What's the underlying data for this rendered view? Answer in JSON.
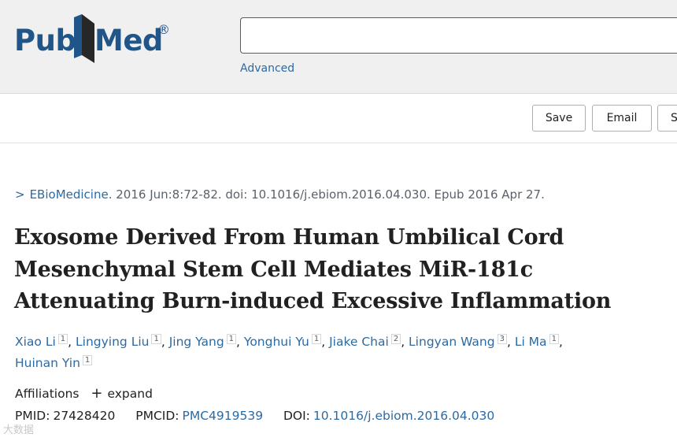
{
  "header": {
    "logo_pub": "Pub",
    "logo_med": "Med",
    "logo_reg": "®",
    "search_placeholder": "",
    "advanced_label": "Advanced",
    "brand_color": "#20558a"
  },
  "actions": {
    "save_label": "Save",
    "email_label": "Email",
    "send_label": "S"
  },
  "article": {
    "citation_chevron": ">",
    "journal": "EBioMedicine.",
    "citation_rest": "2016 Jun:8:72-82. doi: 10.1016/j.ebiom.2016.04.030. Epub 2016 Apr 27.",
    "title": "Exosome Derived From Human Umbilical Cord Mesenchymal Stem Cell Mediates MiR-181c Attenuating Burn-induced Excessive Inflammation",
    "authors": [
      {
        "name": "Xiao Li",
        "aff": "1"
      },
      {
        "name": "Lingying Liu",
        "aff": "1"
      },
      {
        "name": "Jing Yang",
        "aff": "1"
      },
      {
        "name": "Yonghui Yu",
        "aff": "1"
      },
      {
        "name": "Jiake Chai",
        "aff": "2"
      },
      {
        "name": "Lingyan Wang",
        "aff": "3"
      },
      {
        "name": "Li Ma",
        "aff": "1"
      },
      {
        "name": "Huinan Yin",
        "aff": "1"
      }
    ],
    "affiliations_label": "Affiliations",
    "expand_symbol": "+",
    "expand_label": "expand",
    "pmid_label": "PMID:",
    "pmid": "27428420",
    "pmcid_label": "PMCID:",
    "pmcid": "PMC4919539",
    "doi_label": "DOI:",
    "doi": "10.1016/j.ebiom.2016.04.030"
  },
  "watermark": "大数据"
}
